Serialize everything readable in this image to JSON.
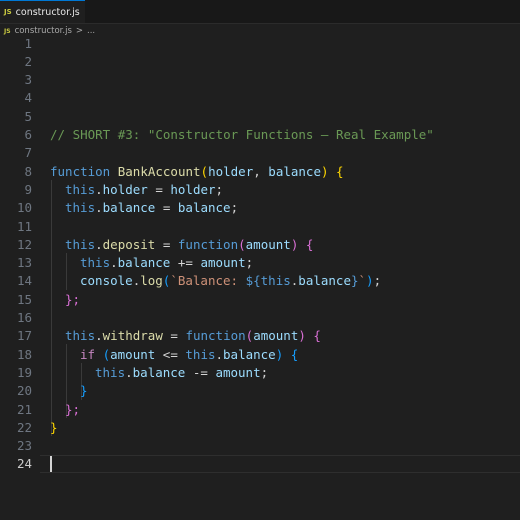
{
  "tab": {
    "icon": "JS",
    "label": "constructor.js"
  },
  "breadcrumb": {
    "icon": "JS",
    "file": "constructor.js",
    "sep": ">",
    "rest": "..."
  },
  "line_numbers": [
    "1",
    "2",
    "3",
    "4",
    "5",
    "6",
    "7",
    "8",
    "9",
    "10",
    "11",
    "12",
    "13",
    "14",
    "15",
    "16",
    "17",
    "18",
    "19",
    "20",
    "21",
    "22",
    "23",
    "24"
  ],
  "code": {
    "comment": "// SHORT #3: \"Constructor Functions – Real Example\"",
    "kw_function": "function",
    "class_name": "BankAccount",
    "lp": "(",
    "rp": ")",
    "lb": "{",
    "rb": "}",
    "param_holder": "holder",
    "param_balance": "balance",
    "param_amount": "amount",
    "comma": ", ",
    "this": "this",
    "dot": ".",
    "prop_holder": "holder",
    "prop_balance": "balance",
    "prop_deposit": "deposit",
    "prop_withdraw": "withdraw",
    "assign": " = ",
    "plus_assign": " += ",
    "minus_assign": " -= ",
    "lte": " <= ",
    "semi": ";",
    "console": "console",
    "log": "log",
    "tpl_open": "`Balance: ",
    "tpl_expr_open": "${",
    "tpl_expr_close": "}",
    "tpl_close": "`",
    "kw_if": "if",
    "close_fn": "};",
    "space": " "
  }
}
